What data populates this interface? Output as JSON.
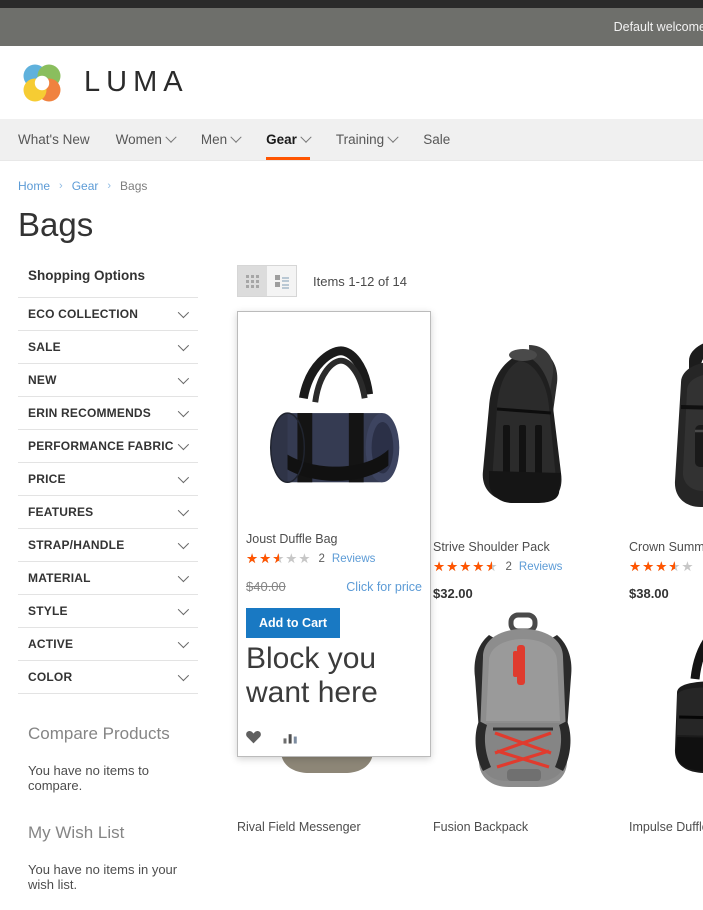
{
  "header": {
    "welcome_message": "Default welcome",
    "logo_text": "LUMA",
    "logo_icon": "luma-flower-logo"
  },
  "nav": {
    "items": [
      {
        "label": "What's New",
        "has_dropdown": false,
        "active": false
      },
      {
        "label": "Women",
        "has_dropdown": true,
        "active": false
      },
      {
        "label": "Men",
        "has_dropdown": true,
        "active": false
      },
      {
        "label": "Gear",
        "has_dropdown": true,
        "active": true
      },
      {
        "label": "Training",
        "has_dropdown": true,
        "active": false
      },
      {
        "label": "Sale",
        "has_dropdown": false,
        "active": false
      }
    ],
    "active_accent": "#ff5501"
  },
  "breadcrumb": {
    "home": "Home",
    "sep": "›",
    "gear": "Gear",
    "current": "Bags"
  },
  "page": {
    "title": "Bags"
  },
  "sidebar": {
    "shopping_options_title": "Shopping Options",
    "filters": [
      {
        "label": "ECO COLLECTION"
      },
      {
        "label": "SALE"
      },
      {
        "label": "NEW"
      },
      {
        "label": "ERIN RECOMMENDS"
      },
      {
        "label": "PERFORMANCE FABRIC"
      },
      {
        "label": "PRICE"
      },
      {
        "label": "FEATURES"
      },
      {
        "label": "STRAP/HANDLE"
      },
      {
        "label": "MATERIAL"
      },
      {
        "label": "STYLE"
      },
      {
        "label": "ACTIVE"
      },
      {
        "label": "COLOR"
      }
    ],
    "compare": {
      "title": "Compare Products",
      "empty_text": "You have no items to compare."
    },
    "wishlist": {
      "title": "My Wish List",
      "empty_text": "You have no items in your wish list."
    }
  },
  "toolbar": {
    "grid_mode_label": "Grid",
    "list_mode_label": "List",
    "active_mode": "Grid",
    "amount_text": "Items 1-12 of 14"
  },
  "products": [
    {
      "name": "Joust Duffle Bag",
      "rating_percent": 50,
      "reviews_count": "2",
      "reviews_label": "Reviews",
      "price": "$40.00",
      "old_price": "$40.00",
      "click_for_price": "Click for price",
      "add_to_cart_label": "Add to Cart",
      "block_text": "Block you want here",
      "wishlist_icon": "heart-icon",
      "compare_icon": "compare-bars-icon",
      "hovered": true,
      "image": "duffle-navy"
    },
    {
      "name": "Strive Shoulder Pack",
      "rating_percent": 90,
      "reviews_count": "2",
      "reviews_label": "Reviews",
      "price": "$32.00",
      "hovered": false,
      "image": "sling-black"
    },
    {
      "name": "Crown Summit Backpack",
      "rating_percent": 70,
      "reviews_count": "",
      "reviews_label": "",
      "price": "$38.00",
      "hovered": false,
      "image": "backpack-black"
    },
    {
      "name": "Rival Field Messenger",
      "rating_percent": 0,
      "reviews_count": "",
      "reviews_label": "",
      "price": "",
      "hovered": false,
      "image": "messenger-tan"
    },
    {
      "name": "Fusion Backpack",
      "rating_percent": 0,
      "reviews_count": "",
      "reviews_label": "",
      "price": "",
      "hovered": false,
      "image": "backpack-gray-red"
    },
    {
      "name": "Impulse Duffle",
      "rating_percent": 0,
      "reviews_count": "",
      "reviews_label": "",
      "price": "",
      "hovered": false,
      "image": "duffle-black"
    }
  ],
  "colors": {
    "accent_orange": "#ff5501",
    "link_blue": "#5c9bd6",
    "button_blue": "#1979c3",
    "star_orange": "#ff5501",
    "panel_gray": "#6e6f6b"
  }
}
